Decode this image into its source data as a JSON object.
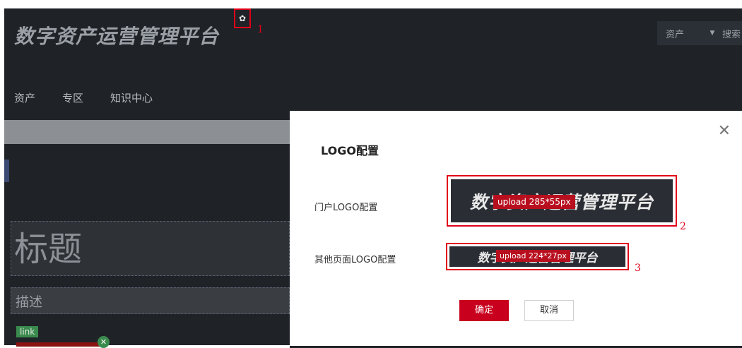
{
  "header": {
    "brand": "数字资产运营管理平台",
    "settings_icon": "gear-icon",
    "annotation_1": "1",
    "asset_select": "资产",
    "search_label": "搜索"
  },
  "nav": {
    "items": [
      "资产",
      "专区",
      "知识中心"
    ]
  },
  "canvas": {
    "title_placeholder": "标题",
    "description_placeholder": "描述",
    "link_tag": "link"
  },
  "dialog": {
    "title": "LOGO配置",
    "portal_logo_label": "门户LOGO配置",
    "other_logo_label": "其他页面LOGO配置",
    "portal_logo_text": "数字资产运营管理平台",
    "other_logo_text": "数字资产运营管理平台",
    "portal_upload_hint": "upload 285*55px",
    "other_upload_hint": "upload 224*27px",
    "annotation_2": "2",
    "annotation_3": "3",
    "confirm_label": "确定",
    "cancel_label": "取消",
    "close_icon": "close-icon"
  },
  "colors": {
    "background": "#1f2227",
    "accent_red": "#c9001d",
    "annotation_red": "#e00018",
    "link_green": "#3a8a4e"
  }
}
